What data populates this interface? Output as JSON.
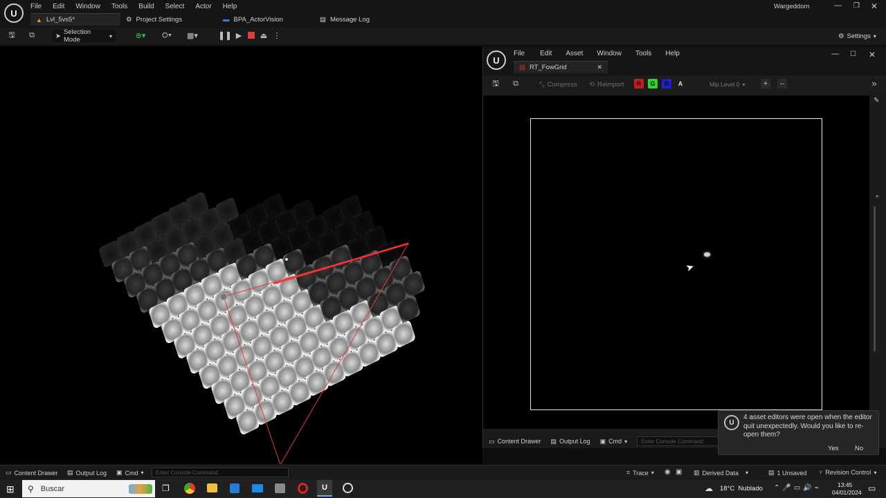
{
  "main": {
    "user_name": "Wargeddom",
    "menu": [
      "File",
      "Edit",
      "Window",
      "Tools",
      "Build",
      "Select",
      "Actor",
      "Help"
    ],
    "tabs": [
      {
        "label": "Lvl_5vs5*"
      },
      {
        "label": "Project Settings"
      },
      {
        "label": "BPA_ActorVision"
      },
      {
        "label": "Message Log"
      }
    ],
    "toolbar": {
      "mode_label": "Selection Mode",
      "settings_label": "Settings"
    }
  },
  "asset_editor": {
    "menu": [
      "File",
      "Edit",
      "Asset",
      "Window",
      "Tools",
      "Help"
    ],
    "tab_label": "RT_FowGrid",
    "toolbar": {
      "compress_label": "Compress",
      "reimport_label": "Reimport",
      "channels": [
        {
          "label": "R",
          "color": "#d62a2a"
        },
        {
          "label": "G",
          "color": "#2fd42f"
        },
        {
          "label": "B",
          "color": "#2a2ad6"
        },
        {
          "label": "A",
          "color": "#e8e8e8"
        }
      ],
      "mip_label": "Mip Level 0"
    },
    "status": {
      "content_drawer": "Content Drawer",
      "output_log": "Output Log",
      "cmd": "Cmd",
      "console_placeholder": "Enter Console Command"
    }
  },
  "toast": {
    "message": "4 asset editors were open when the editor quit unexpectedly. Would you like to re-open them?",
    "yes_label": "Yes",
    "no_label": "No"
  },
  "status_bar": {
    "content_drawer": "Content Drawer",
    "output_log": "Output Log",
    "cmd": "Cmd",
    "console_placeholder": "Enter Console Command",
    "trace": "Trace",
    "derived_data": "Derived Data",
    "unsaved": "1 Unsaved",
    "revision_control": "Revision Control"
  },
  "taskbar": {
    "search_placeholder": "Buscar",
    "weather": "18°C  Nublado",
    "time": "13:45",
    "date": "04/01/2024"
  },
  "colors": {
    "accent_red": "#e03a3a",
    "accent_green": "#2fd42f"
  }
}
